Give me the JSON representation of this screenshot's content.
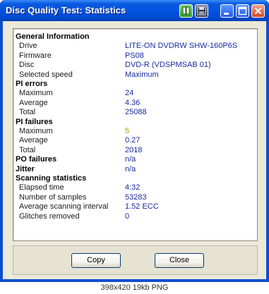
{
  "window": {
    "title": "Disc Quality Test: Statistics"
  },
  "titlebar_buttons": [
    "tile-icon",
    "save-icon",
    "minimize-icon",
    "maximize-icon",
    "close-icon"
  ],
  "rows": [
    {
      "type": "section",
      "label": "General Information",
      "value": ""
    },
    {
      "type": "item",
      "label": "Drive",
      "value": "LITE-ON DVDRW SHW-160P6S"
    },
    {
      "type": "item",
      "label": "Firmware",
      "value": "PS08"
    },
    {
      "type": "item",
      "label": "Disc",
      "value": "DVD-R (VDSPMSAB 01)"
    },
    {
      "type": "item",
      "label": "Selected speed",
      "value": "Maximum"
    },
    {
      "type": "section",
      "label": "PI errors",
      "value": ""
    },
    {
      "type": "item",
      "label": "Maximum",
      "value": "24"
    },
    {
      "type": "item",
      "label": "Average",
      "value": "4.36"
    },
    {
      "type": "item",
      "label": "Total",
      "value": "25088"
    },
    {
      "type": "section",
      "label": "PI failures",
      "value": ""
    },
    {
      "type": "item",
      "label": "Maximum",
      "value": "5",
      "highlight": true
    },
    {
      "type": "item",
      "label": "Average",
      "value": "0.27"
    },
    {
      "type": "item",
      "label": "Total",
      "value": "2018"
    },
    {
      "type": "section",
      "label": "PO failures",
      "value": "n/a"
    },
    {
      "type": "section",
      "label": "Jitter",
      "value": "n/a"
    },
    {
      "type": "section",
      "label": "Scanning statistics",
      "value": ""
    },
    {
      "type": "item",
      "label": "Elapsed time",
      "value": "4:32"
    },
    {
      "type": "item",
      "label": "Number of samples",
      "value": "53283"
    },
    {
      "type": "item",
      "label": "Average scanning interval",
      "value": "1.52 ECC"
    },
    {
      "type": "item",
      "label": "Glitches removed",
      "value": "0"
    }
  ],
  "buttons": {
    "copy": "Copy",
    "close": "Close"
  },
  "caption": "398x420 19kb PNG",
  "colors": {
    "title_bar": "#0053e1",
    "dialog_bg": "#ece9d8",
    "value_text": "#1a2aa0",
    "highlight_value": "#a6a200"
  }
}
